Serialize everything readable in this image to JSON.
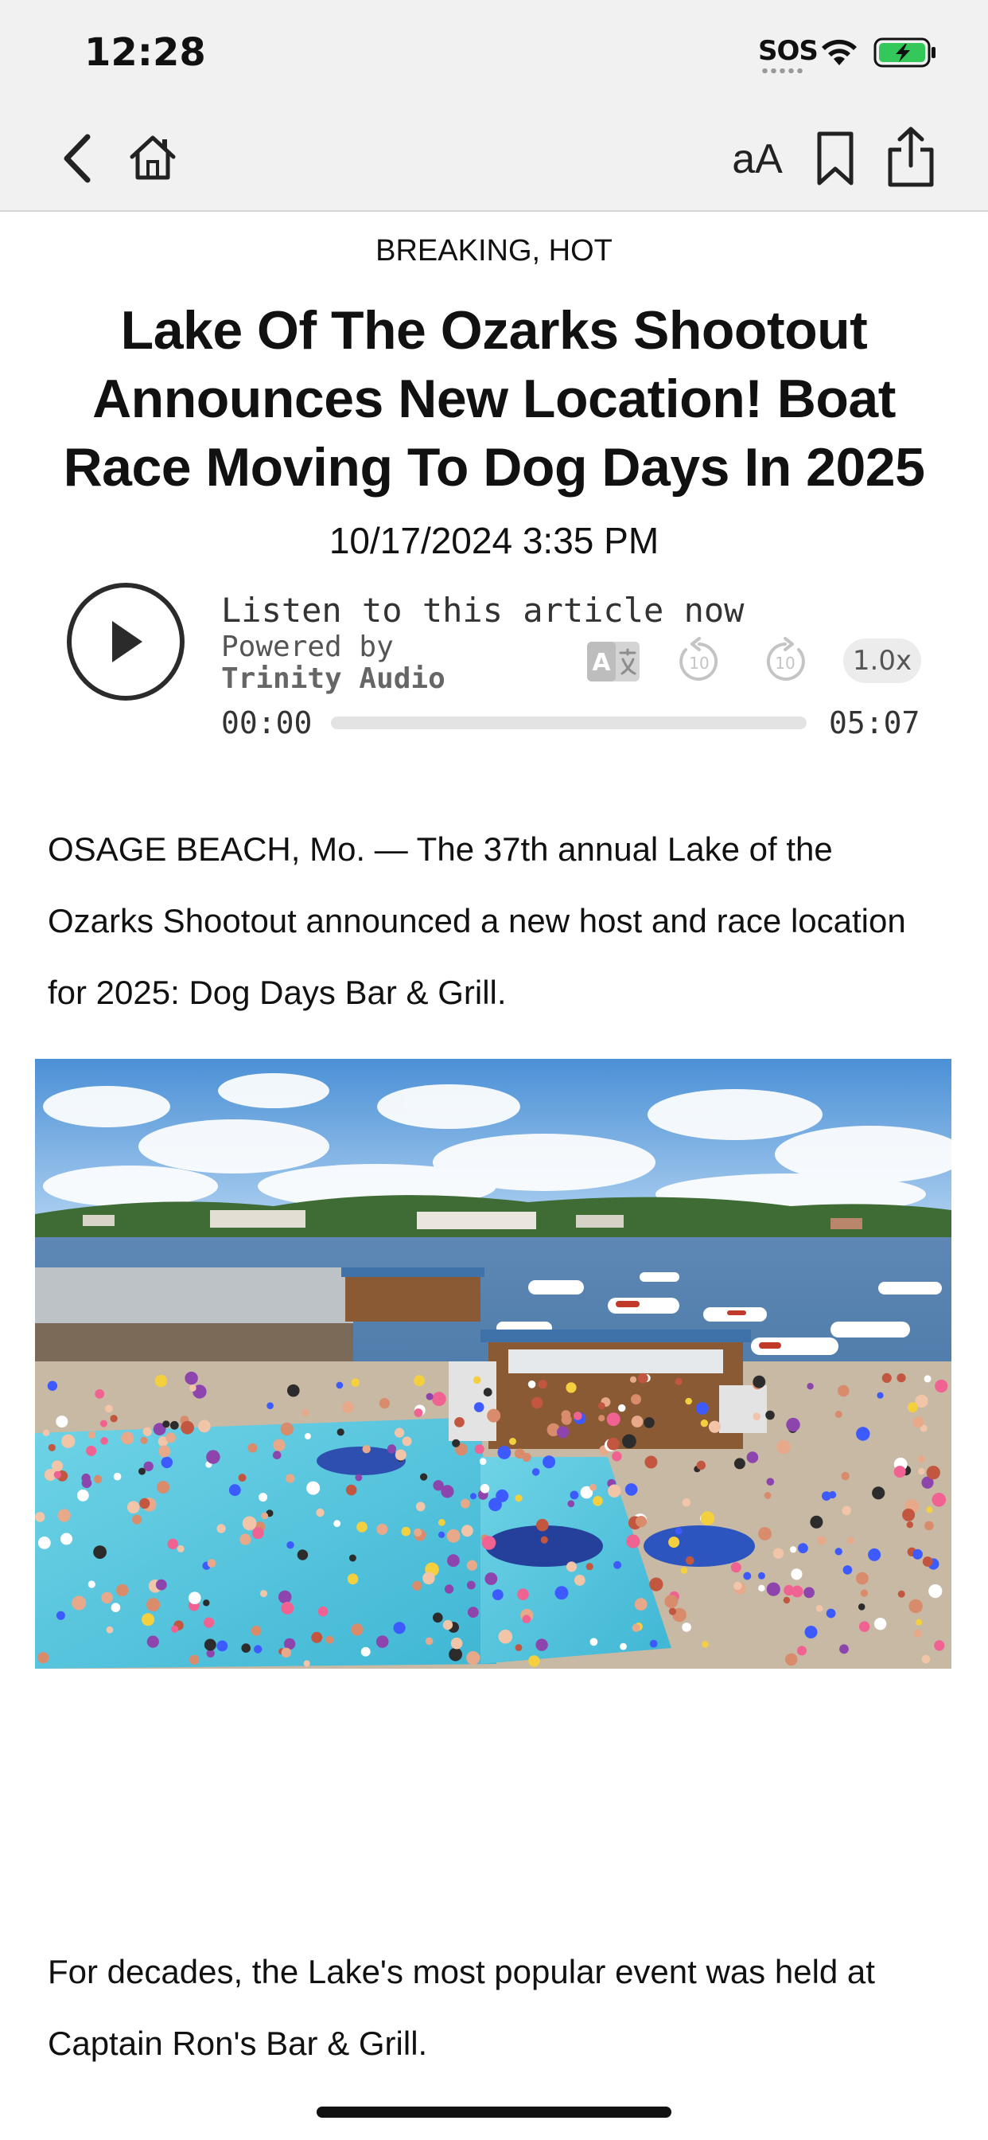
{
  "status_bar": {
    "time": "12:28",
    "sos": "SOS",
    "wifi_icon": "wifi-icon",
    "battery_icon": "battery-charging-icon",
    "battery_color": "#34c759"
  },
  "nav": {
    "back_icon": "chevron-left-icon",
    "home_icon": "home-icon",
    "text_size_label": "aA",
    "bookmark_icon": "bookmark-icon",
    "share_icon": "share-icon"
  },
  "article": {
    "category": "BREAKING, HOT",
    "title": "Lake Of The Ozarks Shootout Announces New Location! Boat Race Moving To Dog Days In 2025",
    "date": "10/17/2024 3:35 PM",
    "paragraph_1": "OSAGE BEACH, Mo. — The 37th annual Lake of the Ozarks Shootout announced a new host and race location for 2025: Dog Days Bar & Grill.",
    "paragraph_2": "For decades, the Lake's most popular event was held at Captain Ron's Bar & Grill."
  },
  "audio": {
    "listen_label": "Listen to this article now",
    "powered_by_label": "Powered by",
    "powered_by_brand": "Trinity Audio",
    "translate_label": "A",
    "rewind_label": "10",
    "forward_label": "10",
    "speed_label": "1.0x",
    "time_current": "00:00",
    "time_total": "05:07",
    "progress": 0
  }
}
